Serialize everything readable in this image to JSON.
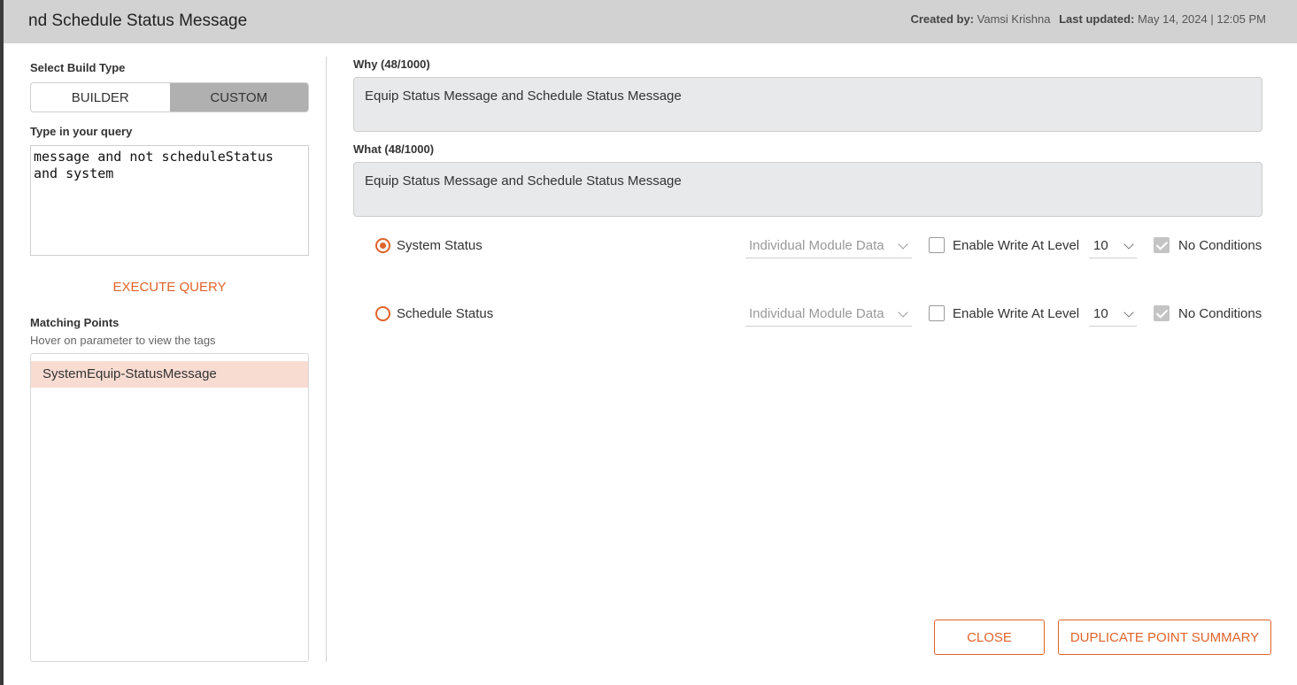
{
  "header": {
    "title": "nd Schedule Status Message",
    "created_by_label": "Created by:",
    "created_by_value": "Vamsi Krishna",
    "last_updated_label": "Last updated:",
    "last_updated_value": "May 14, 2024 | 12:05 PM"
  },
  "left": {
    "build_type_label": "Select Build Type",
    "builder_label": "BUILDER",
    "custom_label": "CUSTOM",
    "query_label": "Type in your query",
    "query_value": "message and not scheduleStatus and system",
    "execute_label": "EXECUTE QUERY",
    "matching_label": "Matching Points",
    "matching_hint": "Hover on parameter to view the tags",
    "points": [
      "SystemEquip-StatusMessage"
    ]
  },
  "right": {
    "why_label": "Why (48/1000)",
    "why_value": "Equip Status Message and Schedule Status Message",
    "what_label": "What (48/1000)",
    "what_value": "Equip Status Message and Schedule Status Message",
    "rows": [
      {
        "label": "System Status",
        "selected": true,
        "data_select": "Individual Module Data",
        "write_label": "Enable Write At Level",
        "level": "10",
        "no_conditions_label": "No Conditions"
      },
      {
        "label": "Schedule Status",
        "selected": false,
        "data_select": "Individual Module Data",
        "write_label": "Enable Write At Level",
        "level": "10",
        "no_conditions_label": "No Conditions"
      }
    ]
  },
  "footer": {
    "close_label": "CLOSE",
    "duplicate_label": "DUPLICATE POINT SUMMARY"
  },
  "colors": {
    "accent": "#e0632a",
    "header_bg": "#d2d2d2",
    "highlight": "#f8dcd2"
  }
}
